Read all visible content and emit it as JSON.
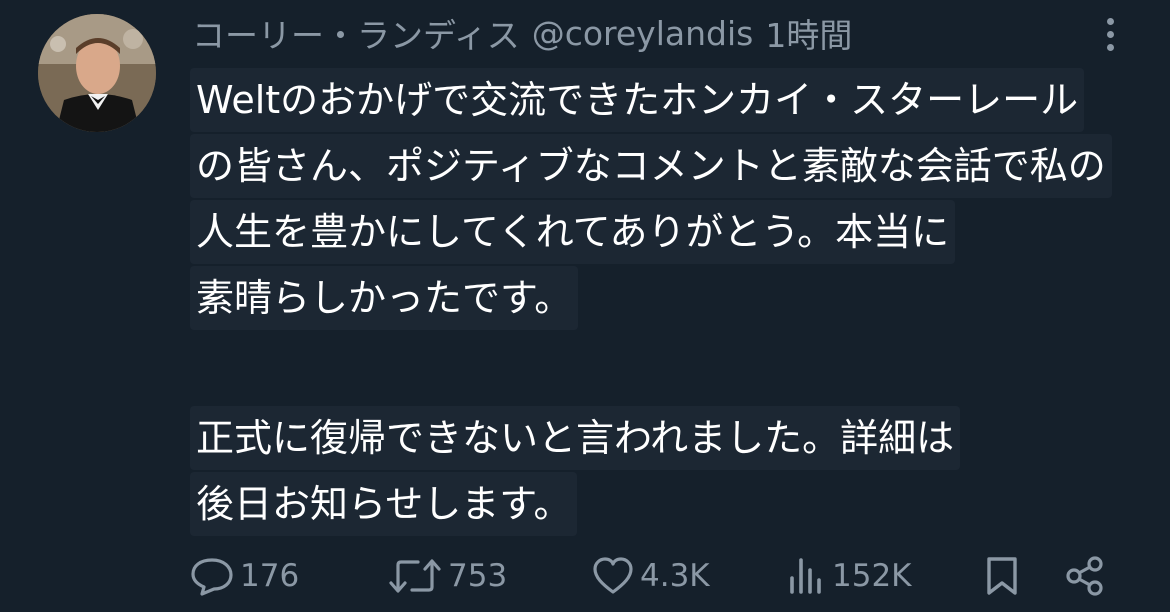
{
  "tweet": {
    "display_name": "コーリー・ランディス",
    "handle": "@coreylandis",
    "time": "1時間",
    "lines": [
      "Weltのおかげで交流できたホンカイ・スターレール",
      "の皆さん、ポジティブなコメントと素敵な会話で私の",
      "人生を豊かにしてくれてありがとう。本当に",
      "素晴らしかったです。",
      "正式に復帰できないと言われました。詳細は",
      "後日お知らせします。"
    ]
  },
  "actions": {
    "replies": "176",
    "retweets": "753",
    "likes": "4.3K",
    "views": "152K"
  },
  "icons": {
    "reply": "reply-icon",
    "retweet": "retweet-icon",
    "like": "heart-icon",
    "views": "views-icon",
    "bookmark": "bookmark-icon",
    "share": "share-icon",
    "more": "more-icon"
  },
  "colors": {
    "background": "#15202b",
    "text": "#ffffff",
    "muted": "#8b98a5"
  }
}
